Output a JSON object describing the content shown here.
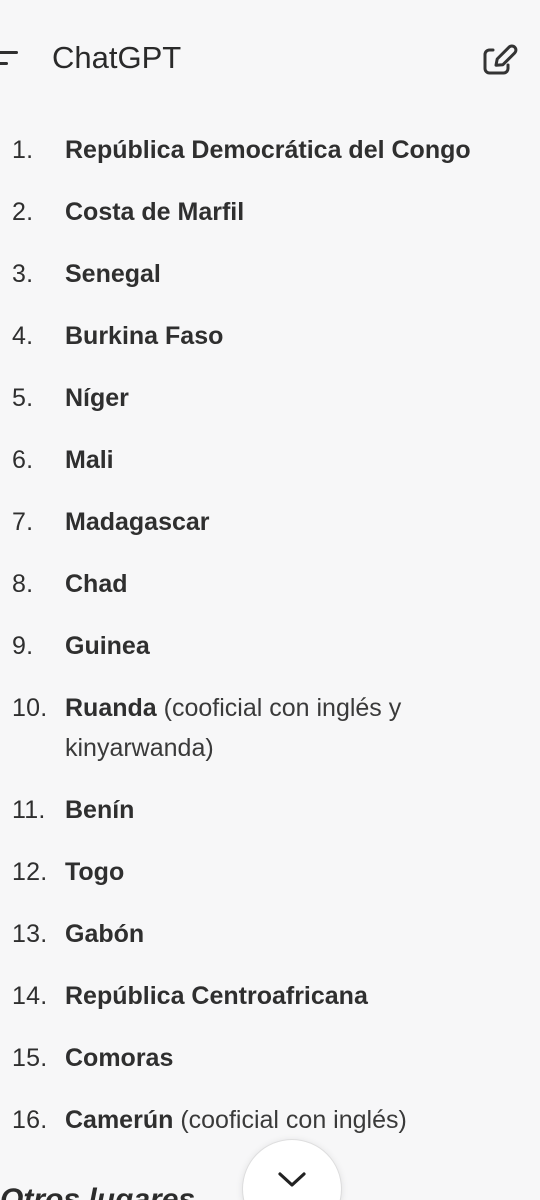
{
  "header": {
    "title": "ChatGPT",
    "menu_icon": "menu-icon",
    "edit_icon": "edit-icon"
  },
  "list": {
    "items": [
      {
        "number": "1.",
        "country": "República Democrática del Congo",
        "note": ""
      },
      {
        "number": "2.",
        "country": "Costa de Marfil",
        "note": ""
      },
      {
        "number": "3.",
        "country": "Senegal",
        "note": ""
      },
      {
        "number": "4.",
        "country": "Burkina Faso",
        "note": ""
      },
      {
        "number": "5.",
        "country": "Níger",
        "note": ""
      },
      {
        "number": "6.",
        "country": "Mali",
        "note": ""
      },
      {
        "number": "7.",
        "country": "Madagascar",
        "note": ""
      },
      {
        "number": "8.",
        "country": "Chad",
        "note": ""
      },
      {
        "number": "9.",
        "country": "Guinea",
        "note": ""
      },
      {
        "number": "10.",
        "country": "Ruanda",
        "note": "(cooficial con inglés y kinyarwanda)"
      },
      {
        "number": "11.",
        "country": "Benín",
        "note": ""
      },
      {
        "number": "12.",
        "country": "Togo",
        "note": ""
      },
      {
        "number": "13.",
        "country": "Gabón",
        "note": ""
      },
      {
        "number": "14.",
        "country": "República Centroafricana",
        "note": ""
      },
      {
        "number": "15.",
        "country": "Comoras",
        "note": ""
      },
      {
        "number": "16.",
        "country": "Camerún",
        "note": "(cooficial con inglés)"
      }
    ]
  },
  "bottom": {
    "partial_heading": "Otros lugares",
    "scroll_icon": "chevron-down-icon"
  },
  "colors": {
    "background": "#f7f7f8",
    "text": "#2f2f2f",
    "button": "#ffffff"
  }
}
